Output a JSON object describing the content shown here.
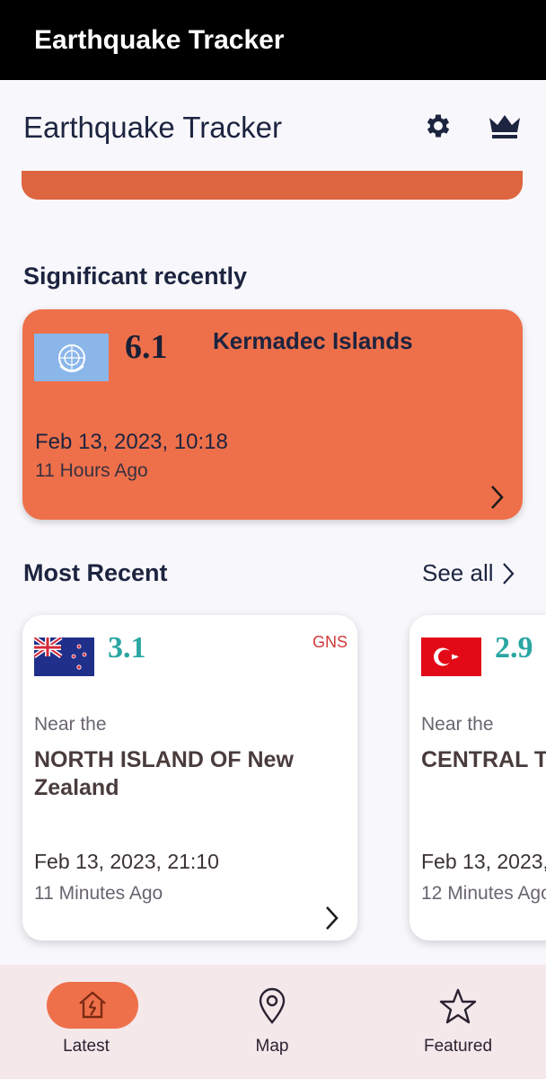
{
  "window": {
    "title": "Earthquake Tracker"
  },
  "app_bar": {
    "title": "Earthquake Tracker",
    "settings_icon": "gear-icon",
    "premium_icon": "crown-icon"
  },
  "sections": {
    "significant": "Significant recently",
    "most_recent": "Most Recent",
    "see_all": "See all"
  },
  "significant": {
    "flag": "un-flag",
    "magnitude": "6.1",
    "place": "Kermadec Islands",
    "date": "Feb 13, 2023, 10:18",
    "ago": "11 Hours Ago",
    "color": "#ee704a"
  },
  "recent": [
    {
      "flag": "new-zealand-flag",
      "magnitude": "3.1",
      "source": "GNS",
      "near": "Near the",
      "place": "NORTH ISLAND OF New Zealand",
      "date": "Feb 13, 2023, 21:10",
      "ago": "11 Minutes Ago"
    },
    {
      "flag": "turkey-flag",
      "magnitude": "2.9",
      "near": "Near the",
      "place": "CENTRAL T",
      "date": "Feb 13, 2023,",
      "ago": "12 Minutes Ago"
    }
  ],
  "bottom_nav": {
    "items": [
      {
        "label": "Latest",
        "icon": "house-quake-icon",
        "active": true
      },
      {
        "label": "Map",
        "icon": "map-pin-icon",
        "active": false
      },
      {
        "label": "Featured",
        "icon": "star-icon",
        "active": false
      }
    ]
  },
  "colors": {
    "accent": "#ee704a",
    "magnitude_teal": "#2aa6a2",
    "source_red": "#d13b3b",
    "nav_bg": "#f4e8ea"
  }
}
